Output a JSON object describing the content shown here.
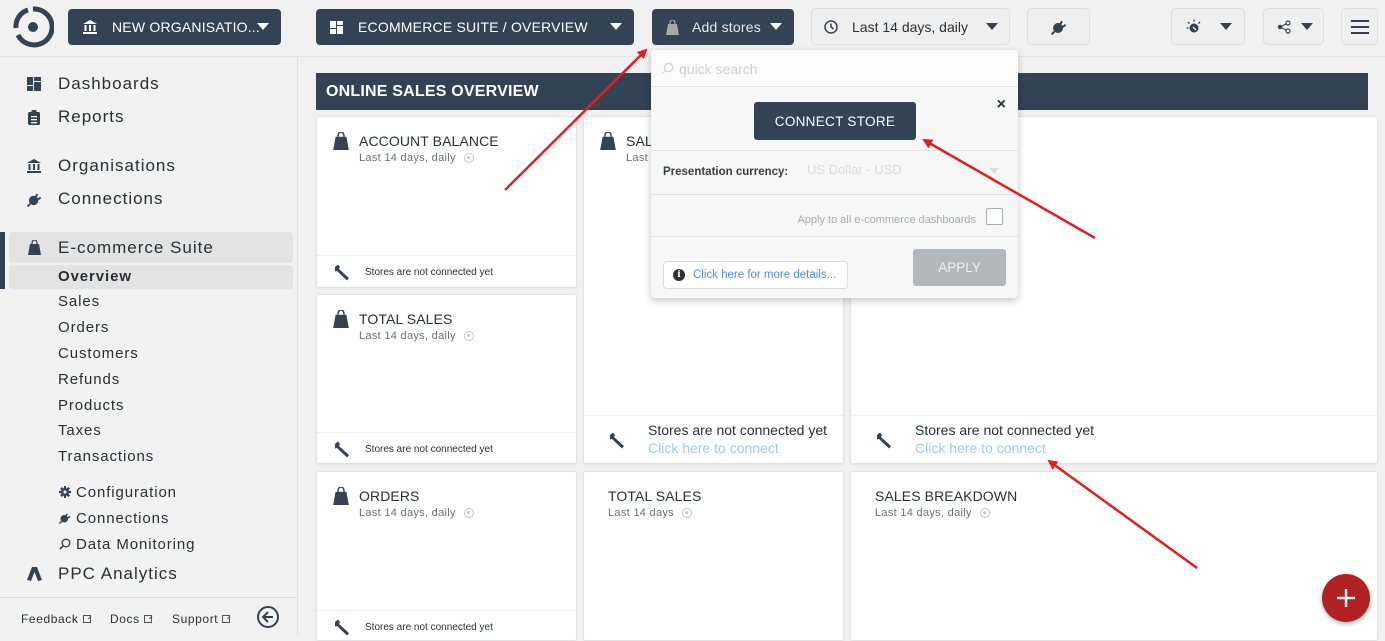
{
  "topbar": {
    "org_selector": {
      "label": "NEW ORGANISATIO...",
      "icon": "bank-icon"
    },
    "dashboard_selector": {
      "label": "ECOMMERCE SUITE / OVERVIEW",
      "icon": "dashboard-grid-icon"
    },
    "stores_selector": {
      "label": "Add stores",
      "icon": "shopping-bag-icon"
    },
    "date_selector": {
      "label": "Last 14 days, daily",
      "icon": "clock-icon"
    },
    "connections_button": {
      "icon": "plug-icon"
    },
    "theme_button": {
      "icon": "bulb-icon"
    },
    "share_button": {
      "icon": "share-icon"
    },
    "menu_button": {
      "icon": "hamburger-icon"
    }
  },
  "sidebar": {
    "items": [
      {
        "label": "Dashboards",
        "icon": "dashboard-grid-icon"
      },
      {
        "label": "Reports",
        "icon": "clipboard-icon"
      },
      {
        "label": "Organisations",
        "icon": "bank-icon"
      },
      {
        "label": "Connections",
        "icon": "plug-icon"
      },
      {
        "label": "E-commerce Suite",
        "icon": "shopping-bag-icon",
        "active": true
      },
      {
        "label": "PPC Analytics",
        "icon": "ads-icon"
      }
    ],
    "ecommerce_sub": [
      "Overview",
      "Sales",
      "Orders",
      "Customers",
      "Refunds",
      "Products",
      "Taxes",
      "Transactions"
    ],
    "selected_sub": "Overview",
    "ecommerce_tools": [
      {
        "label": "Configuration",
        "icon": "gear-icon"
      },
      {
        "label": "Connections",
        "icon": "plug-icon"
      },
      {
        "label": "Data Monitoring",
        "icon": "search-icon"
      }
    ],
    "footer": {
      "feedback": "Feedback",
      "docs": "Docs",
      "support": "Support"
    }
  },
  "main": {
    "section_title": "ONLINE SALES OVERVIEW",
    "not_connected": "Stores are not connected yet",
    "connect_link": "Click here to connect",
    "cards": [
      {
        "title": "ACCOUNT BALANCE",
        "subtitle": "Last 14 days, daily"
      },
      {
        "title": "SAL",
        "subtitle": "Last"
      },
      {
        "title": "TOTAL SALES",
        "subtitle": "Last 14 days, daily"
      },
      {
        "title": "ORDERS",
        "subtitle": "Last 14 days, daily"
      },
      {
        "title": "TOTAL SALES",
        "subtitle": "Last 14 days"
      },
      {
        "title": "SALES BREAKDOWN",
        "subtitle": "Last 14 days, daily"
      }
    ]
  },
  "popup": {
    "search_placeholder": "quick search",
    "connect_button": "CONNECT STORE",
    "close": "×",
    "currency_label": "Presentation currency:",
    "currency_value": "US Dollar - USD",
    "apply_all_label": "Apply to all e-commerce dashboards",
    "apply_all_checked": false,
    "details_link": "Click here for more details...",
    "info_glyph": "i",
    "apply_button": "APPLY"
  },
  "fab": {
    "icon": "plus-icon"
  },
  "colors": {
    "navy": "#334254",
    "fab_red": "#b22222",
    "link_blue": "#4a90d9",
    "light_link": "#9ccaf0",
    "annotation_red": "#e02020"
  }
}
